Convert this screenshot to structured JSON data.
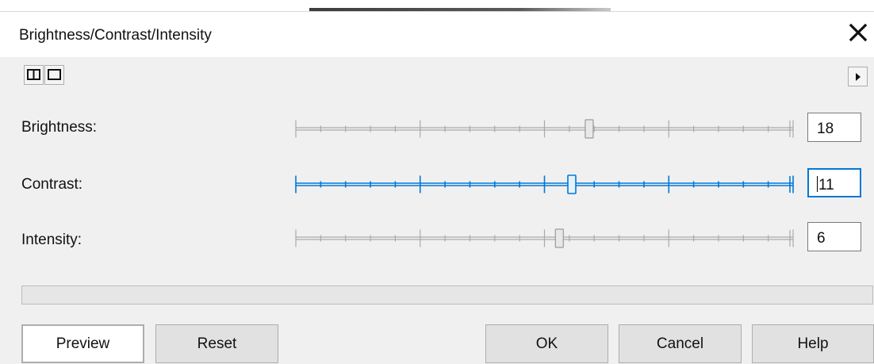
{
  "dialog": {
    "title": "Brightness/Contrast/Intensity",
    "close_glyph": "✕"
  },
  "toolbar": {
    "icons": [
      "split-view-icon",
      "single-view-icon",
      "expand-arrow-icon"
    ]
  },
  "sliders": [
    {
      "label": "Brightness:",
      "value": "18",
      "min": -100,
      "max": 100,
      "focused": false
    },
    {
      "label": "Contrast:",
      "value": "11",
      "min": -100,
      "max": 100,
      "focused": true
    },
    {
      "label": "Intensity:",
      "value": "6",
      "min": -100,
      "max": 100,
      "focused": false
    }
  ],
  "progress": {
    "value": 0
  },
  "buttons": {
    "preview": "Preview",
    "reset": "Reset",
    "ok": "OK",
    "cancel": "Cancel",
    "help": "Help"
  },
  "colors": {
    "accent": "#0078d7",
    "slider_inactive": "#a9a9a9",
    "dialog_bg": "#f0f0f0"
  }
}
